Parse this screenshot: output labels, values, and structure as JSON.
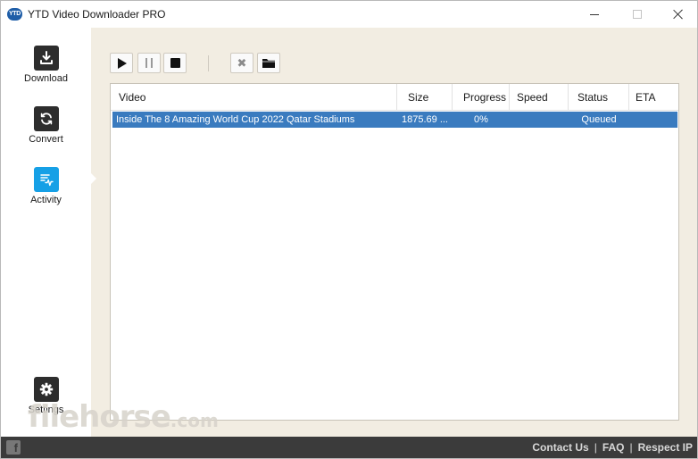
{
  "window": {
    "title": "YTD Video Downloader PRO",
    "logo_text": "YTD"
  },
  "sidebar": {
    "items": [
      {
        "label": "Download",
        "icon": "download-icon"
      },
      {
        "label": "Convert",
        "icon": "convert-icon"
      },
      {
        "label": "Activity",
        "icon": "activity-icon",
        "active": true
      },
      {
        "label": "Settings",
        "icon": "gear-icon"
      }
    ]
  },
  "toolbar": {
    "buttons": [
      "play-icon",
      "pause-icon",
      "stop-icon",
      "cancel-icon",
      "folder-icon"
    ],
    "cancel_glyph": "✖"
  },
  "table": {
    "columns": [
      "Video",
      "Size",
      "Progress",
      "Speed",
      "Status",
      "ETA"
    ],
    "rows": [
      {
        "video": "Inside The 8 Amazing World Cup 2022 Qatar Stadiums",
        "size": "1875.69 ...",
        "progress": "0%",
        "speed": "",
        "status": "Queued",
        "eta": ""
      }
    ]
  },
  "footer": {
    "facebook_glyph": "f",
    "links": [
      "Contact Us",
      "FAQ",
      "Respect IP"
    ],
    "separator": "|"
  },
  "watermark": {
    "text": "filehorse",
    "suffix": ".com"
  },
  "colors": {
    "accent": "#16a0e6",
    "selection": "#3a7bbf",
    "footer_bg": "#3b3b3b",
    "logo_bg": "#1f5ea8"
  }
}
